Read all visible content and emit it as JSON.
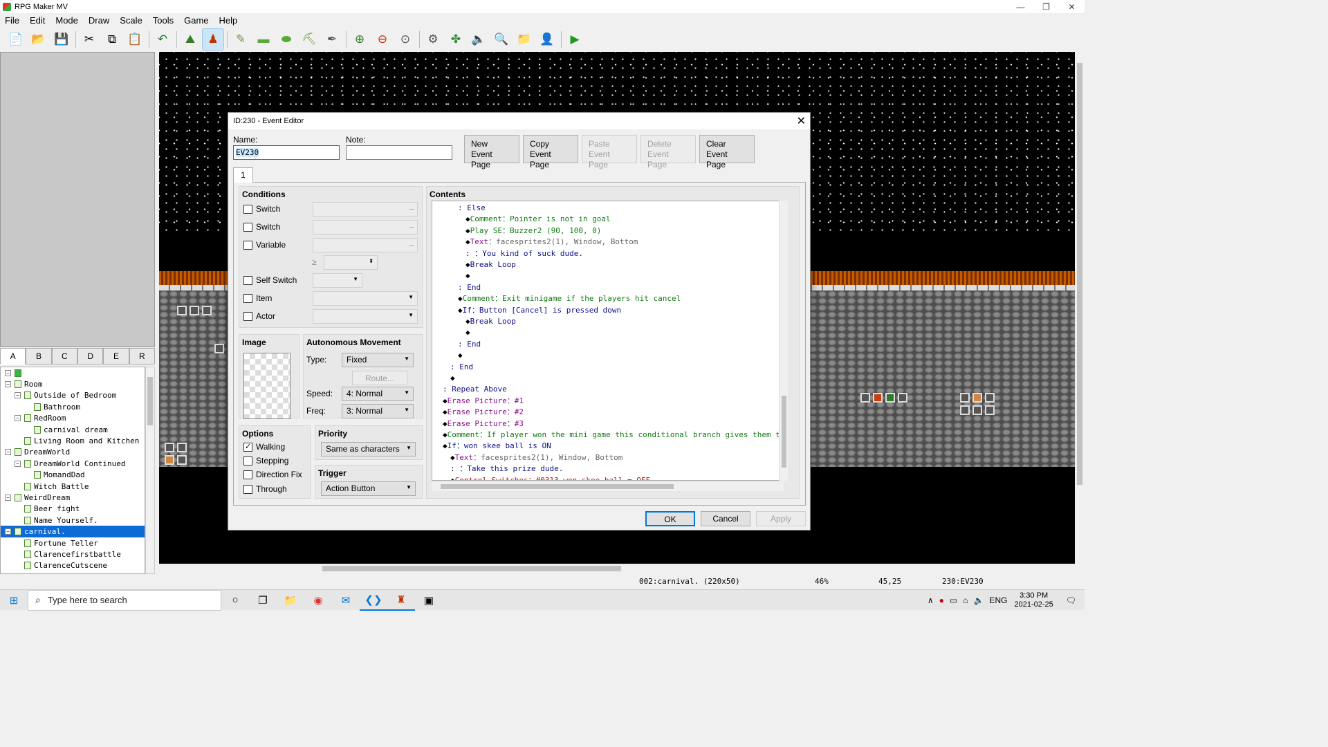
{
  "app": {
    "title": "RPG Maker MV",
    "controls": [
      "—",
      "❐",
      "✕"
    ]
  },
  "menu": [
    "File",
    "Edit",
    "Mode",
    "Draw",
    "Scale",
    "Tools",
    "Game",
    "Help"
  ],
  "palette_tabs": [
    "A",
    "B",
    "C",
    "D",
    "E",
    "R"
  ],
  "map_tree": [
    {
      "label": "",
      "depth": 0,
      "toggle": "⊟",
      "type": "root"
    },
    {
      "label": "Room",
      "depth": 0,
      "toggle": "⊟"
    },
    {
      "label": "Outside of Bedroom",
      "depth": 1,
      "toggle": "⊟"
    },
    {
      "label": "Bathroom",
      "depth": 2,
      "toggle": ""
    },
    {
      "label": "RedRoom",
      "depth": 1,
      "toggle": "⊟"
    },
    {
      "label": "carnival dream",
      "depth": 2,
      "toggle": ""
    },
    {
      "label": "Living Room and Kitchen",
      "depth": 1,
      "toggle": ""
    },
    {
      "label": "DreamWorld",
      "depth": 0,
      "toggle": "⊟"
    },
    {
      "label": "DreamWorld Continued",
      "depth": 1,
      "toggle": "⊟"
    },
    {
      "label": "MomandDad",
      "depth": 2,
      "toggle": ""
    },
    {
      "label": "Witch Battle",
      "depth": 1,
      "toggle": ""
    },
    {
      "label": "WeirdDream",
      "depth": 0,
      "toggle": "⊟"
    },
    {
      "label": "Beer fight",
      "depth": 1,
      "toggle": ""
    },
    {
      "label": "Name Yourself.",
      "depth": 1,
      "toggle": ""
    },
    {
      "label": "carnival.",
      "depth": 0,
      "toggle": "⊟",
      "selected": true
    },
    {
      "label": "Fortune Teller",
      "depth": 1,
      "toggle": ""
    },
    {
      "label": "Clarencefirstbattle",
      "depth": 1,
      "toggle": ""
    },
    {
      "label": "ClarenceCutscene",
      "depth": 1,
      "toggle": ""
    }
  ],
  "status": {
    "map": "002:carnival. (220x50)",
    "zoom": "46%",
    "coords": "45,25",
    "event": "230:EV230"
  },
  "taskbar": {
    "search_placeholder": "Type here to search",
    "lang": "ENG",
    "time": "3:30 PM",
    "date": "2021-02-25"
  },
  "dialog": {
    "title": "ID:230 - Event Editor",
    "name_label": "Name:",
    "name_value": "EV230",
    "note_label": "Note:",
    "note_value": "",
    "buttons": [
      {
        "l1": "New",
        "l2": "Event Page",
        "enabled": true
      },
      {
        "l1": "Copy",
        "l2": "Event Page",
        "enabled": true
      },
      {
        "l1": "Paste",
        "l2": "Event Page",
        "enabled": false
      },
      {
        "l1": "Delete",
        "l2": "Event Page",
        "enabled": false
      },
      {
        "l1": "Clear",
        "l2": "Event Page",
        "enabled": true
      }
    ],
    "page_tab": "1",
    "conditions": {
      "title": "Conditions",
      "switch1": "Switch",
      "switch2": "Switch",
      "variable": "Variable",
      "ge": "≥",
      "self_switch": "Self Switch",
      "item": "Item",
      "actor": "Actor",
      "dots": "..."
    },
    "image": {
      "title": "Image"
    },
    "autonomous": {
      "title": "Autonomous Movement",
      "type_label": "Type:",
      "type_value": "Fixed",
      "route": "Route...",
      "speed_label": "Speed:",
      "speed_value": "4: Normal",
      "freq_label": "Freq:",
      "freq_value": "3: Normal"
    },
    "options": {
      "title": "Options",
      "walking": "Walking",
      "walking_checked": true,
      "stepping": "Stepping",
      "direction_fix": "Direction Fix",
      "through": "Through"
    },
    "priority": {
      "title": "Priority",
      "value": "Same as characters"
    },
    "trigger": {
      "title": "Trigger",
      "value": "Action Button"
    },
    "contents_title": "Contents",
    "contents": [
      {
        "indent": 3,
        "parts": [
          {
            "t": ": ",
            "c": "k-blue"
          },
          {
            "t": "Else",
            "c": "k-blue"
          }
        ]
      },
      {
        "indent": 4,
        "parts": [
          {
            "t": "◆",
            "c": ""
          },
          {
            "t": "Comment：Pointer is not in goal",
            "c": "k-green"
          }
        ]
      },
      {
        "indent": 4,
        "parts": [
          {
            "t": "◆",
            "c": ""
          },
          {
            "t": "Play SE：Buzzer2 (90, 100, 0)",
            "c": "k-green"
          }
        ]
      },
      {
        "indent": 4,
        "parts": [
          {
            "t": "◆",
            "c": ""
          },
          {
            "t": "Text",
            "c": "k-purple"
          },
          {
            "t": "：facesprites2(1), Window, Bottom",
            "c": "k-gray"
          }
        ]
      },
      {
        "indent": 4,
        "parts": [
          {
            "t": ":      ",
            "c": ""
          },
          {
            "t": "：You kind of suck dude.",
            "c": "k-blue"
          }
        ]
      },
      {
        "indent": 4,
        "parts": [
          {
            "t": "◆",
            "c": ""
          },
          {
            "t": "Break Loop",
            "c": "k-blue"
          }
        ]
      },
      {
        "indent": 4,
        "parts": [
          {
            "t": "◆",
            "c": ""
          }
        ]
      },
      {
        "indent": 3,
        "parts": [
          {
            "t": ": ",
            "c": "k-blue"
          },
          {
            "t": "End",
            "c": "k-blue"
          }
        ]
      },
      {
        "indent": 3,
        "parts": [
          {
            "t": "◆",
            "c": ""
          },
          {
            "t": "Comment：Exit minigame if the players hit cancel",
            "c": "k-green"
          }
        ]
      },
      {
        "indent": 3,
        "parts": [
          {
            "t": "◆",
            "c": ""
          },
          {
            "t": "If：Button [Cancel] is pressed down",
            "c": "k-blue"
          }
        ]
      },
      {
        "indent": 4,
        "parts": [
          {
            "t": "◆",
            "c": ""
          },
          {
            "t": "Break Loop",
            "c": "k-blue"
          }
        ]
      },
      {
        "indent": 4,
        "parts": [
          {
            "t": "◆",
            "c": ""
          }
        ]
      },
      {
        "indent": 3,
        "parts": [
          {
            "t": ": ",
            "c": "k-blue"
          },
          {
            "t": "End",
            "c": "k-blue"
          }
        ]
      },
      {
        "indent": 3,
        "parts": [
          {
            "t": "◆",
            "c": ""
          }
        ]
      },
      {
        "indent": 2,
        "parts": [
          {
            "t": ": ",
            "c": "k-blue"
          },
          {
            "t": "End",
            "c": "k-blue"
          }
        ]
      },
      {
        "indent": 2,
        "parts": [
          {
            "t": "◆",
            "c": ""
          }
        ]
      },
      {
        "indent": 1,
        "parts": [
          {
            "t": ": ",
            "c": "k-blue"
          },
          {
            "t": "Repeat Above",
            "c": "k-blue"
          }
        ]
      },
      {
        "indent": 1,
        "parts": [
          {
            "t": "◆",
            "c": ""
          },
          {
            "t": "Erase Picture：#1",
            "c": "k-purple"
          }
        ]
      },
      {
        "indent": 1,
        "parts": [
          {
            "t": "◆",
            "c": ""
          },
          {
            "t": "Erase Picture：#2",
            "c": "k-purple"
          }
        ]
      },
      {
        "indent": 1,
        "parts": [
          {
            "t": "◆",
            "c": ""
          },
          {
            "t": "Erase Picture：#3",
            "c": "k-purple"
          }
        ]
      },
      {
        "indent": 1,
        "parts": [
          {
            "t": "◆",
            "c": ""
          },
          {
            "t": "Comment：If player won the mini game this conditional branch gives them the reward",
            "c": "k-green"
          }
        ]
      },
      {
        "indent": 1,
        "parts": [
          {
            "t": "◆",
            "c": ""
          },
          {
            "t": "If：won skee ball is ON",
            "c": "k-blue"
          }
        ]
      },
      {
        "indent": 2,
        "parts": [
          {
            "t": "◆",
            "c": ""
          },
          {
            "t": "Text",
            "c": "k-purple"
          },
          {
            "t": "：facesprites2(1), Window, Bottom",
            "c": "k-gray"
          }
        ]
      },
      {
        "indent": 2,
        "parts": [
          {
            "t": ":      ",
            "c": ""
          },
          {
            "t": "：Take this prize dude.",
            "c": "k-blue"
          }
        ]
      },
      {
        "indent": 2,
        "parts": [
          {
            "t": "◆",
            "c": ""
          },
          {
            "t": "Control Switches：#0313 won skee ball = OFF",
            "c": "k-red"
          }
        ]
      }
    ],
    "ok": "OK",
    "cancel": "Cancel",
    "apply": "Apply"
  }
}
